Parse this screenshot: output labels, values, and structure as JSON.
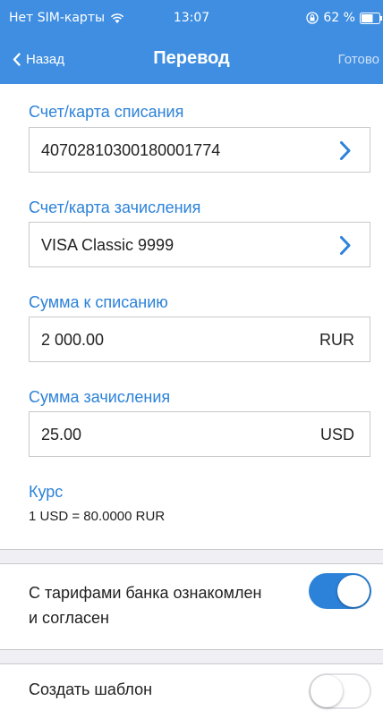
{
  "status_bar": {
    "carrier": "Нет SIM-карты",
    "time": "13:07",
    "battery": "62 %"
  },
  "nav": {
    "back_label": "Назад",
    "title": "Перевод",
    "done_label": "Готово"
  },
  "form": {
    "debit_account": {
      "label": "Счет/карта списания",
      "value": "40702810300180001774"
    },
    "credit_account": {
      "label": "Счет/карта зачисления",
      "value": "VISA Classic 9999"
    },
    "debit_amount": {
      "label": "Сумма к списанию",
      "value": "2 000.00",
      "currency": "RUR"
    },
    "credit_amount": {
      "label": "Сумма зачисления",
      "value": "25.00",
      "currency": "USD"
    },
    "rate": {
      "label": "Курс",
      "value": "1 USD = 80.0000 RUR"
    }
  },
  "settings": {
    "tariffs_agreement": {
      "label_line1": "С тарифами банка ознакомлен",
      "label_line2": "и согласен",
      "enabled": true
    },
    "create_template": {
      "label": "Создать шаблон",
      "enabled": false
    }
  },
  "colors": {
    "nav_background": "#3f8ee1",
    "accent": "#2c82d8",
    "separator": "#efeff4"
  }
}
